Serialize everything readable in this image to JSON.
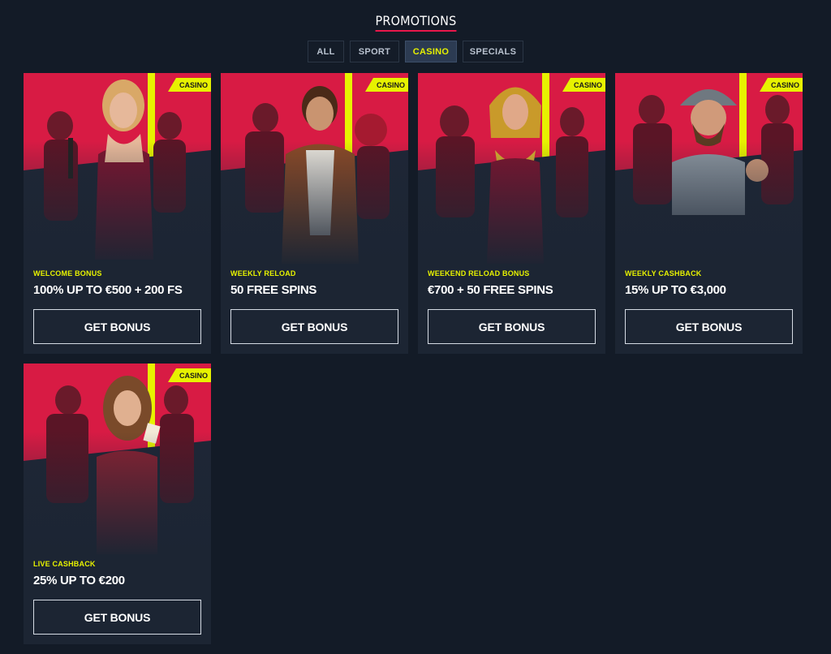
{
  "page": {
    "title": "PROMOTIONS"
  },
  "filters": {
    "tabs": [
      {
        "label": "ALL"
      },
      {
        "label": "SPORT"
      },
      {
        "label": "CASINO",
        "active": true
      },
      {
        "label": "SPECIALS"
      }
    ]
  },
  "colors": {
    "background": "#131b27",
    "card": "#1c2533",
    "accent_yellow": "#e7f200",
    "accent_red": "#e8174b",
    "art_red": "#d81b44"
  },
  "promotions": [
    {
      "badge": "CASINO",
      "category": "WELCOME BONUS",
      "offer": "100% UP TO €500 + 200 FS",
      "button": "GET BONUS",
      "art": "woman-with-microphone-illustration"
    },
    {
      "badge": "CASINO",
      "category": "WEEKLY RELOAD",
      "offer": "50 FREE SPINS",
      "button": "GET BONUS",
      "art": "adventurer-man-illustration"
    },
    {
      "badge": "CASINO",
      "category": "WEEKEND RELOAD BONUS",
      "offer": "€700 + 50 FREE SPINS",
      "button": "GET BONUS",
      "art": "cleopatra-illustration"
    },
    {
      "badge": "CASINO",
      "category": "WEEKLY CASHBACK",
      "offer": "15% UP TO €3,000",
      "button": "GET BONUS",
      "art": "conquistador-thumbs-up-illustration"
    },
    {
      "badge": "CASINO",
      "category": "LIVE CASHBACK",
      "offer": "25% UP TO €200",
      "button": "GET BONUS",
      "art": "woman-with-cards-illustration"
    }
  ]
}
